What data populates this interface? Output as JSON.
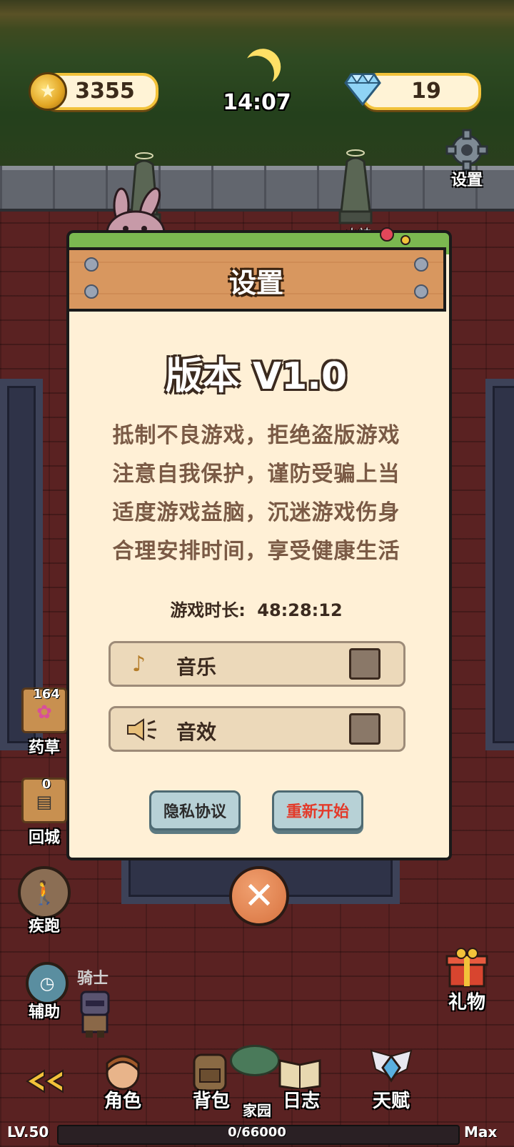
{
  "hud": {
    "coins": "3355",
    "gems": "19",
    "time": "14:07",
    "settings_label": "设置",
    "statue_label": "山神"
  },
  "dialog": {
    "title": "设置",
    "version": "版本 V1.0",
    "notice_lines": [
      "抵制不良游戏，拒绝盗版游戏",
      "注意自我保护，谨防受骗上当",
      "适度游戏益脑，沉迷游戏伤身",
      "合理安排时间，享受健康生活"
    ],
    "playtime_label": "游戏时长:",
    "playtime_value": "48:28:12",
    "music_label": "音乐",
    "sfx_label": "音效",
    "privacy_label": "隐私协议",
    "restart_label": "重新开始"
  },
  "side_left": {
    "herb_count": "164",
    "herb_label": "药草",
    "town_count": "0",
    "town_label": "回城",
    "run_label": "疾跑",
    "assist_label": "辅助",
    "knight_label": "骑士"
  },
  "side_right": {
    "gift_label": "礼物"
  },
  "bottom": {
    "character_label": "角色",
    "bag_label": "背包",
    "home_label": "家园",
    "journal_label": "日志",
    "talent_label": "天赋",
    "level": "LV.50",
    "xp": "0/66000",
    "max": "Max",
    "xp_fraction": 0
  },
  "colors": {
    "restart_text": "#e33a2a",
    "pill_border": "#f2c23a",
    "dialog_bg": "#fff0d6"
  }
}
